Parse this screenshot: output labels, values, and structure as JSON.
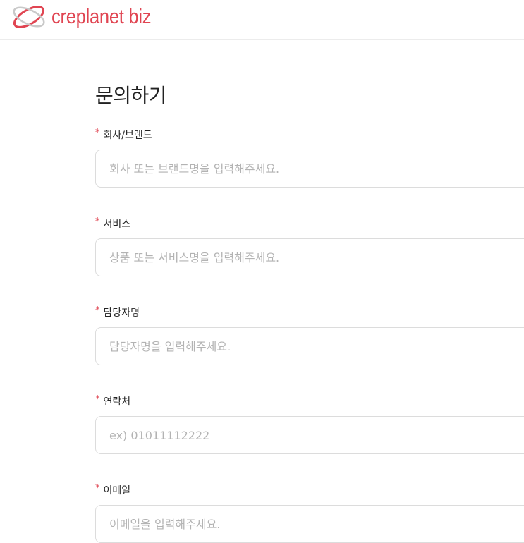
{
  "brand": {
    "name": "creplanet biz",
    "color": "#e04552",
    "logo_icon": "orbit-logo-icon"
  },
  "page": {
    "title": "문의하기"
  },
  "form": {
    "required_marker": "*",
    "fields": [
      {
        "label": "회사/브랜드",
        "value": "",
        "placeholder": "회사 또는 브랜드명을 입력해주세요."
      },
      {
        "label": "서비스",
        "value": "",
        "placeholder": "상품 또는 서비스명을 입력해주세요."
      },
      {
        "label": "담당자명",
        "value": "",
        "placeholder": "담당자명을 입력해주세요."
      },
      {
        "label": "연락처",
        "value": "",
        "placeholder": "ex) 01011112222"
      },
      {
        "label": "이메일",
        "value": "",
        "placeholder": "이메일을 입력해주세요."
      }
    ]
  }
}
